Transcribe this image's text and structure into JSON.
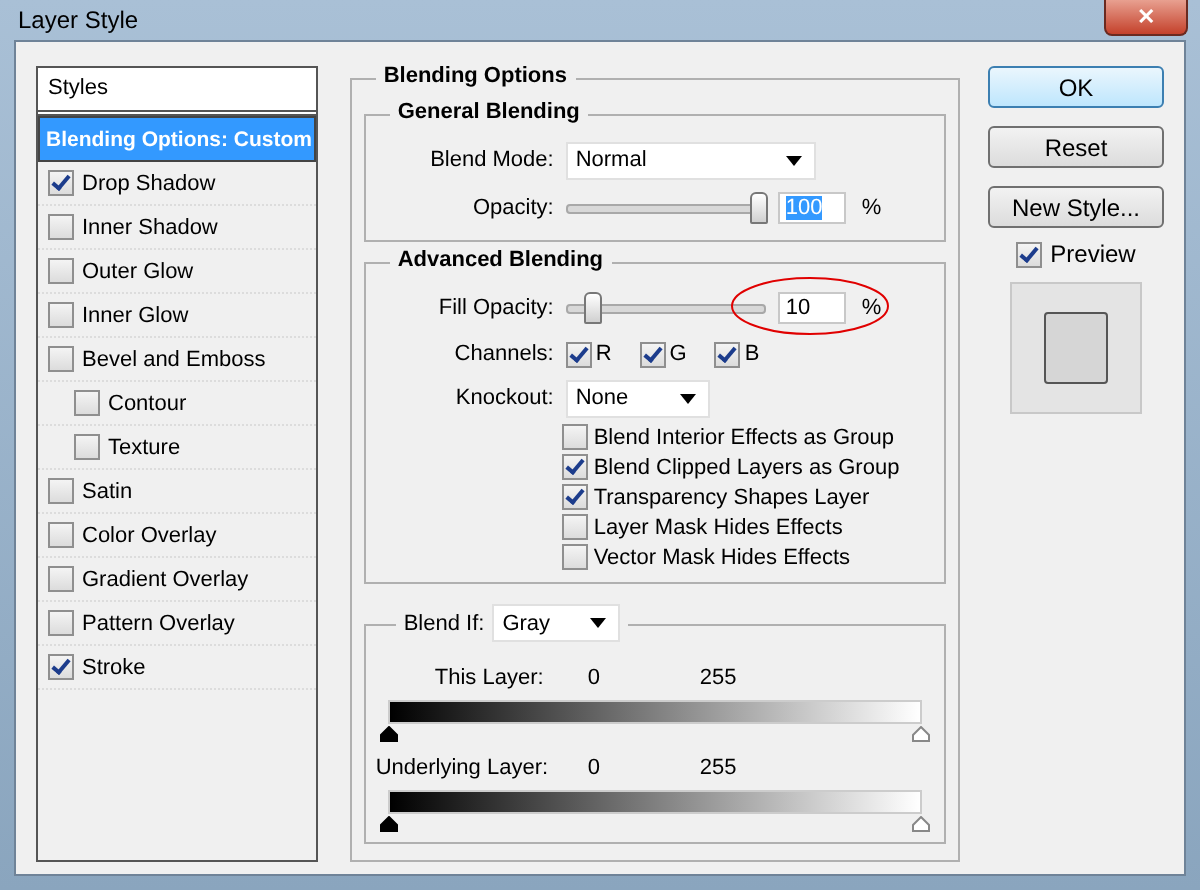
{
  "window": {
    "title": "Layer Style",
    "close": "✕"
  },
  "styles": {
    "header": "Styles",
    "items": [
      {
        "label": "Blending Options: Custom",
        "kind": "plain",
        "selected": true
      },
      {
        "label": "Drop Shadow",
        "kind": "check",
        "checked": true,
        "selected": false
      },
      {
        "label": "Inner Shadow",
        "kind": "check",
        "checked": false,
        "selected": false
      },
      {
        "label": "Outer Glow",
        "kind": "check",
        "checked": false,
        "selected": false
      },
      {
        "label": "Inner Glow",
        "kind": "check",
        "checked": false,
        "selected": false
      },
      {
        "label": "Bevel and Emboss",
        "kind": "check",
        "checked": false,
        "selected": false,
        "children": [
          {
            "label": "Contour",
            "kind": "check",
            "checked": false,
            "selected": false
          },
          {
            "label": "Texture",
            "kind": "check",
            "checked": false,
            "selected": false
          }
        ]
      },
      {
        "label": "Satin",
        "kind": "check",
        "checked": false,
        "selected": false
      },
      {
        "label": "Color Overlay",
        "kind": "check",
        "checked": false,
        "selected": false
      },
      {
        "label": "Gradient Overlay",
        "kind": "check",
        "checked": false,
        "selected": false
      },
      {
        "label": "Pattern Overlay",
        "kind": "check",
        "checked": false,
        "selected": false
      },
      {
        "label": "Stroke",
        "kind": "check",
        "checked": true,
        "selected": false
      }
    ]
  },
  "blending_options": {
    "title": "Blending Options",
    "general": {
      "title": "General Blending",
      "blend_mode_label": "Blend Mode:",
      "blend_mode": "Normal",
      "opacity_label": "Opacity:",
      "opacity": {
        "level": 1,
        "value": "100",
        "value_selected": true
      },
      "unit": "%"
    },
    "advanced": {
      "title": "Advanced Blending",
      "fill_label": "Fill Opacity:",
      "fill": {
        "level": 0.1,
        "value": "10",
        "value_selected": false,
        "circled": true
      },
      "unit": "%",
      "channels_label": "Channels:",
      "channels": [
        {
          "label": "R",
          "checked": true
        },
        {
          "label": "G",
          "checked": true
        },
        {
          "label": "B",
          "checked": true
        }
      ],
      "knockout_label": "Knockout:",
      "knockout": "None",
      "options": [
        {
          "label": "Blend Interior Effects as Group",
          "checked": false
        },
        {
          "label": "Blend Clipped Layers as Group",
          "checked": true
        },
        {
          "label": "Transparency Shapes Layer",
          "checked": true
        },
        {
          "label": "Layer Mask Hides Effects",
          "checked": false
        },
        {
          "label": "Vector Mask Hides Effects",
          "checked": false
        }
      ]
    },
    "blend_if": {
      "label": "Blend If:",
      "value": "Gray",
      "rows": [
        {
          "label": "This Layer:",
          "low": "0",
          "high": "255"
        },
        {
          "label": "Underlying Layer:",
          "low": "0",
          "high": "255"
        }
      ]
    }
  },
  "buttons": [
    {
      "label": "OK",
      "default": true
    },
    {
      "label": "Reset",
      "default": false
    },
    {
      "label": "New Style...",
      "default": false
    }
  ],
  "preview": {
    "label": "Preview",
    "checked": true
  }
}
